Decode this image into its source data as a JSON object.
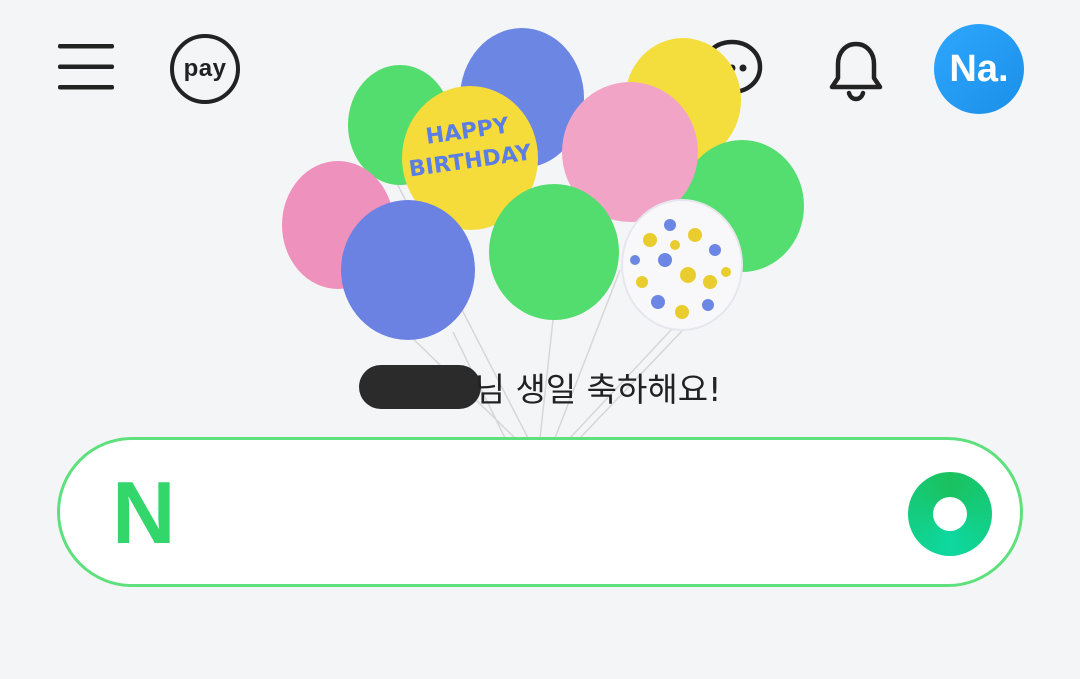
{
  "header": {
    "pay_label": "pay",
    "avatar_label": "Na.",
    "icons": [
      "menu-icon",
      "pay-icon",
      "chat-icon",
      "bell-icon"
    ]
  },
  "birthday": {
    "balloon_text_line1": "HAPPY",
    "balloon_text_line2": "BIRTHDAY",
    "greeting": "님 생일 축하해요!"
  },
  "search": {
    "logo_letter": "N",
    "value": "",
    "placeholder": ""
  },
  "colors": {
    "brand_green": "#33d66b",
    "avatar_blue": "#1b8fe8",
    "background": "#f4f5f7"
  }
}
